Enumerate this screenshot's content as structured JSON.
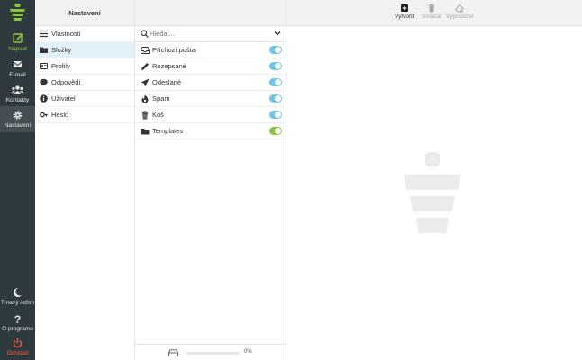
{
  "rail": {
    "items": [
      {
        "label": "Napsat",
        "icon": "compose-icon"
      },
      {
        "label": "E-mail",
        "icon": "envelope-icon"
      },
      {
        "label": "Kontakty",
        "icon": "contacts-icon"
      },
      {
        "label": "Nastavení",
        "icon": "gear-icon"
      }
    ],
    "bottom": [
      {
        "label": "Tmavý režim",
        "icon": "moon-icon"
      },
      {
        "label": "O programu",
        "icon": "question-icon"
      },
      {
        "label": "Odhlásit",
        "icon": "power-icon"
      }
    ]
  },
  "nav": {
    "title": "Nastavení",
    "items": [
      {
        "label": "Vlastnosti",
        "icon": "sliders-icon"
      },
      {
        "label": "Složky",
        "icon": "folder-icon"
      },
      {
        "label": "Profily",
        "icon": "id-card-icon"
      },
      {
        "label": "Odpovědi",
        "icon": "comment-icon"
      },
      {
        "label": "Uživatel",
        "icon": "info-icon"
      },
      {
        "label": "Heslo",
        "icon": "key-icon"
      }
    ]
  },
  "folders": {
    "search_placeholder": "Hledat...",
    "items": [
      {
        "label": "Příchozí pošta",
        "icon": "inbox-icon",
        "subscribed": true
      },
      {
        "label": "Rozepsané",
        "icon": "pencil-icon",
        "subscribed": true
      },
      {
        "label": "Odeslané",
        "icon": "paper-plane-icon",
        "subscribed": true
      },
      {
        "label": "Spam",
        "icon": "fire-icon",
        "subscribed": true
      },
      {
        "label": "Koš",
        "icon": "trash-icon",
        "subscribed": true
      },
      {
        "label": "Templates",
        "icon": "folder-icon",
        "subscribed": true
      }
    ],
    "quota": {
      "percent": 0,
      "label": "0%"
    }
  },
  "toolbar": {
    "create": "Vytvořit",
    "delete": "Smazat",
    "purge": "Vyprázdnit"
  },
  "colors": {
    "accent_green": "#8cc63f",
    "toggle_blue": "#6cc6e8",
    "rail_bg": "#2f3a3f",
    "logout_red": "#f05a4a"
  }
}
